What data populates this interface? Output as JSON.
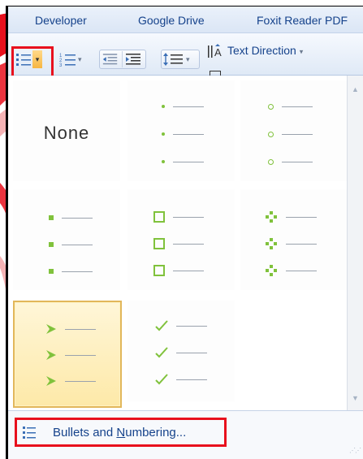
{
  "ribbon": {
    "tabs": [
      "Developer",
      "Google Drive",
      "Foxit Reader PDF"
    ]
  },
  "toolbar": {
    "text_direction_label": "Text Direction",
    "dropdown_caret": "▾"
  },
  "gallery": {
    "none_label": "None",
    "bullet_styles": [
      "none",
      "dot",
      "circle",
      "square-small",
      "square-hollow",
      "diamond-cluster",
      "arrow",
      "checkmark"
    ],
    "selected": "arrow"
  },
  "footer": {
    "label_prefix": "Bullets and ",
    "label_underlined": "N",
    "label_suffix": "umbering..."
  },
  "colors": {
    "bullet_green": "#80c23c",
    "highlight_red": "#e8101d",
    "ribbon_text": "#15428b",
    "selected_border": "#e2b75b"
  }
}
